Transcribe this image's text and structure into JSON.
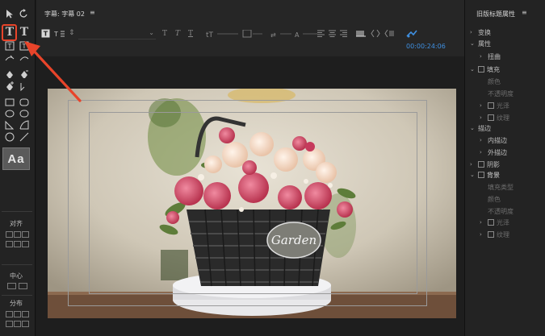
{
  "title_bar": {
    "title": "字幕: 字幕 02",
    "menu_glyph": "≡"
  },
  "toolbar": {
    "timecode": "00:00:24:06"
  },
  "tools": {
    "type_tool": "T",
    "vertical_type_tool": "T",
    "style_swatch": "Aa",
    "align_label": "对齐",
    "center_label": "中心",
    "distribute_label": "分布"
  },
  "panel": {
    "title": "旧版标题属性",
    "menu_glyph": "≡",
    "rows": [
      {
        "label": "变换",
        "arrow": "›",
        "level": 0
      },
      {
        "label": "属性",
        "arrow": "⌄",
        "level": 0
      },
      {
        "label": "扭曲",
        "arrow": "›",
        "level": 1
      },
      {
        "label": "填充",
        "arrow": "⌄",
        "level": 0,
        "checkbox": true
      },
      {
        "label": "颜色",
        "level": 1,
        "dim": true
      },
      {
        "label": "不透明度",
        "level": 1,
        "dim": true
      },
      {
        "label": "光泽",
        "arrow": "›",
        "level": 1,
        "checkbox": true,
        "dim": true
      },
      {
        "label": "纹理",
        "arrow": "›",
        "level": 1,
        "checkbox": true,
        "dim": true
      },
      {
        "label": "描边",
        "arrow": "⌄",
        "level": 0
      },
      {
        "label": "内描边",
        "arrow": "›",
        "level": 1
      },
      {
        "label": "外描边",
        "arrow": "›",
        "level": 1
      },
      {
        "label": "阴影",
        "arrow": "›",
        "level": 0,
        "checkbox": true
      },
      {
        "label": "背景",
        "arrow": "⌄",
        "level": 0,
        "checkbox": true,
        "bright": true
      },
      {
        "label": "填充类型",
        "level": 1,
        "dim": true
      },
      {
        "label": "颜色",
        "level": 1,
        "dim": true
      },
      {
        "label": "不透明度",
        "level": 1,
        "dim": true
      },
      {
        "label": "光泽",
        "arrow": "›",
        "level": 1,
        "checkbox": true,
        "dim": true
      },
      {
        "label": "纹理",
        "arrow": "›",
        "level": 1,
        "checkbox": true,
        "dim": true
      }
    ]
  },
  "canvas": {
    "basket_tag": "Garden"
  },
  "colors": {
    "accent_blue": "#3f8fe0",
    "highlight_red": "#e8442a"
  }
}
